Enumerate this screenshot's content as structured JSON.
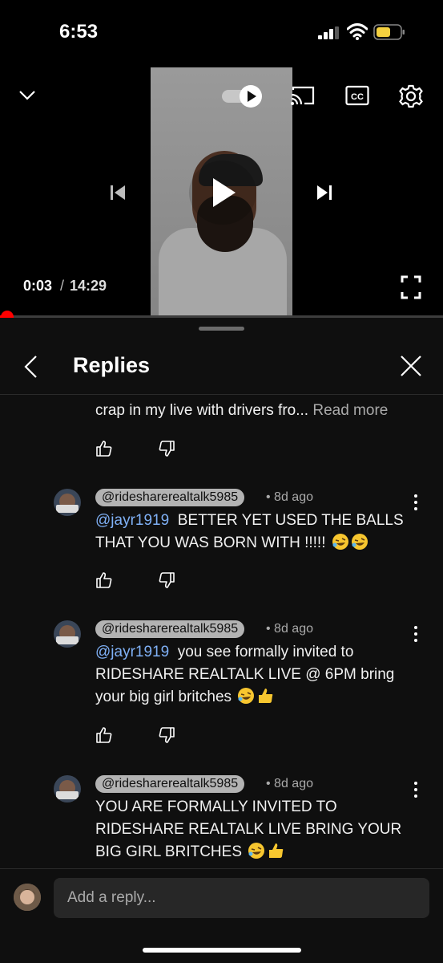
{
  "status_bar": {
    "time": "6:53"
  },
  "player": {
    "current_time": "0:03",
    "separator": "/",
    "total_time": "14:29",
    "progress_fraction": 0.0035
  },
  "panel": {
    "title": "Replies",
    "partial_comment": {
      "text": "crap in my live with drivers fro...",
      "read_more": "Read more"
    },
    "replies": [
      {
        "handle": "@ridesharerealtalk5985",
        "age": "• 8d ago",
        "mention": "@jayr1919",
        "text": "BETTER YET USED THE BALLS THAT YOU WAS BORN WITH !!!!!",
        "emojis": [
          "rofl",
          "rofl"
        ]
      },
      {
        "handle": "@ridesharerealtalk5985",
        "age": "• 8d ago",
        "mention": "@jayr1919",
        "text": "you see formally invited to RIDESHARE REALTALK LIVE @ 6PM bring your big girl britches",
        "emojis": [
          "rofl",
          "thumbs-up"
        ]
      },
      {
        "handle": "@ridesharerealtalk5985",
        "age": "• 8d ago",
        "mention": "",
        "text": "YOU ARE FORMALLY INVITED TO RIDESHARE REALTALK LIVE BRING YOUR BIG GIRL BRITCHES",
        "emojis": [
          "rofl",
          "thumbs-up"
        ]
      }
    ]
  },
  "composer": {
    "placeholder": "Add a reply..."
  },
  "colors": {
    "accent": "#ff0000",
    "mention": "#7fb0f5",
    "background": "#0f0f0f"
  }
}
